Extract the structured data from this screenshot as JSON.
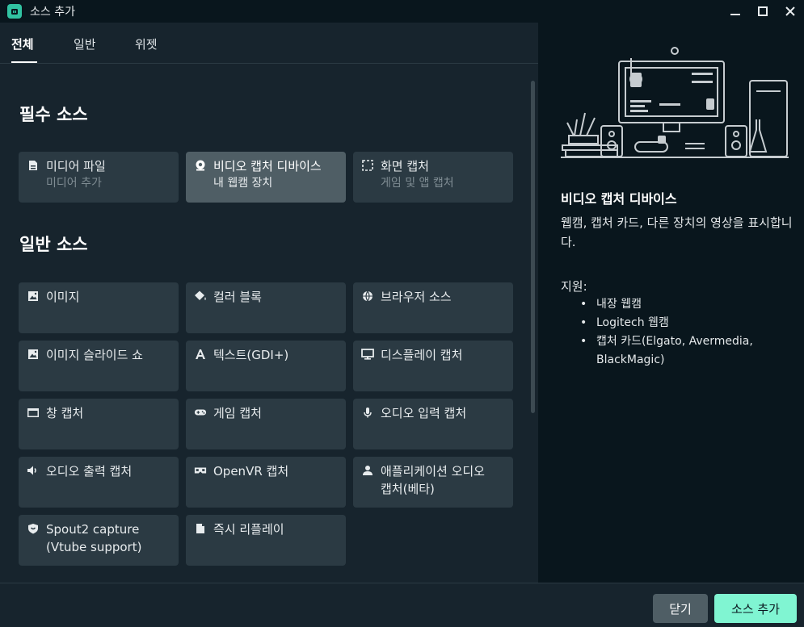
{
  "window": {
    "title": "소스 추가"
  },
  "tabs": [
    {
      "label": "전체"
    },
    {
      "label": "일반"
    },
    {
      "label": "위젯"
    }
  ],
  "sections": {
    "essential": "필수 소스",
    "general": "일반 소스"
  },
  "essential_sources": [
    {
      "label": "미디어 파일",
      "sub": "미디어 추가",
      "icon": "file-icon"
    },
    {
      "label": "비디오 캡처 디바이스",
      "sub": "내 웹캠 장치",
      "icon": "webcam-icon",
      "selected": true
    },
    {
      "label": "화면 캡처",
      "sub": "게임 및 앱 캡처",
      "icon": "screen-capture-icon"
    }
  ],
  "general_sources": [
    {
      "label": "이미지",
      "icon": "image-icon"
    },
    {
      "label": "컬러 블록",
      "icon": "paint-bucket-icon"
    },
    {
      "label": "브라우저 소스",
      "icon": "globe-icon"
    },
    {
      "label": "이미지 슬라이드 쇼",
      "icon": "image-icon"
    },
    {
      "label": "텍스트(GDI+)",
      "icon": "text-icon"
    },
    {
      "label": "디스플레이 캡처",
      "icon": "monitor-icon"
    },
    {
      "label": "창 캡처",
      "icon": "window-icon"
    },
    {
      "label": "게임 캡처",
      "icon": "gamepad-icon"
    },
    {
      "label": "오디오 입력 캡처",
      "icon": "microphone-icon"
    },
    {
      "label": "오디오 출력 캡처",
      "icon": "speaker-icon"
    },
    {
      "label": "OpenVR 캡처",
      "icon": "vr-headset-icon"
    },
    {
      "label": "애플리케이션 오디오",
      "label2": "캡처(베타)",
      "icon": "user-icon"
    },
    {
      "label": "Spout2 capture",
      "label2": "(Vtube support)",
      "icon": "shield-icon"
    },
    {
      "label": "즉시 리플레이",
      "icon": "document-icon"
    }
  ],
  "details": {
    "title": "비디오 캡처 디바이스",
    "description": "웹캠, 캡처 카드, 다른 장치의 영상을 표시합니다.",
    "support_label": "지원:",
    "support_items": [
      "내장 웹캠",
      "Logitech 웹캠",
      "캡처 카드(Elgato, Avermedia,",
      "BlackMagic)"
    ]
  },
  "footer": {
    "close_label": "닫기",
    "add_label": "소스 추가"
  },
  "colors": {
    "accent": "#80f5d2",
    "brand": "#31c3a2",
    "card": "#2b3a43",
    "card_selected": "#4f5e65",
    "panel_dark": "#09161d",
    "background": "#17242d"
  }
}
